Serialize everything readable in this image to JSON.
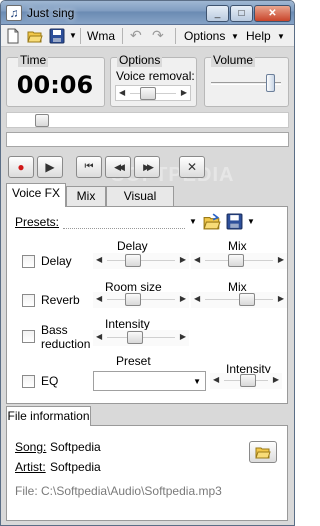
{
  "window": {
    "title": "Just sing",
    "min": "_",
    "max": "□",
    "close": "✕"
  },
  "menu": {
    "format": "Wma",
    "options": "Options",
    "help": "Help"
  },
  "time": {
    "label": "Time",
    "value": "00:06"
  },
  "options": {
    "label": "Options",
    "voice_removal": "Voice removal:",
    "voice_removal_level": 0.35
  },
  "volume": {
    "label": "Volume",
    "level": 0.9
  },
  "position": {
    "level": 0.1
  },
  "watermark": "SOFTPEDIA",
  "transport": {
    "record": "●",
    "play": "▶",
    "first": "⏮",
    "rewind": "◀◀",
    "forward": "▶▶",
    "stop": "✕"
  },
  "tabs": [
    "Voice FX",
    "Mix",
    "Visual Meter"
  ],
  "voicefx": {
    "presets_label": "Presets:",
    "rows": [
      {
        "name": "Delay",
        "param": "Delay",
        "param_level": 0.35,
        "mix": "Mix",
        "mix_level": 0.45
      },
      {
        "name": "Reverb",
        "param": "Room size",
        "param_level": 0.35,
        "mix": "Mix",
        "mix_level": 0.65
      },
      {
        "name": "Bass\nreduction",
        "param": "Intensity",
        "param_level": 0.4
      },
      {
        "name": "EQ",
        "param": "Preset",
        "mix": "Intensity",
        "mix_level": 0.55
      }
    ]
  },
  "fileinfo": {
    "tab": "File information",
    "song_label": "Song:",
    "song": "Softpedia",
    "artist_label": "Artist:",
    "artist": "Softpedia",
    "file": "File: C:\\Softpedia\\Audio\\Softpedia.mp3"
  }
}
